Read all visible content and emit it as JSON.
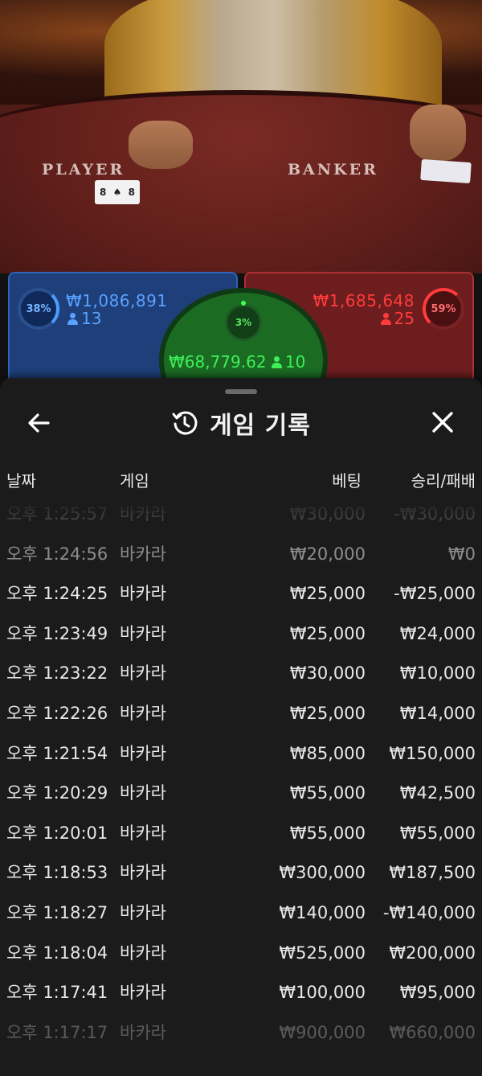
{
  "video": {
    "player_label": "PLAYER",
    "banker_label": "BANKER",
    "card_rank_top": "8",
    "card_rank_bottom": "8"
  },
  "bets": {
    "player": {
      "percent": "38%",
      "amount": "₩1,086,891",
      "players": "13",
      "color": "#5aa2ff"
    },
    "banker": {
      "percent": "59%",
      "amount": "₩1,685,648",
      "players": "25",
      "color": "#ff3b3b"
    },
    "tie": {
      "percent": "3%",
      "amount": "₩68,779.62",
      "players": "10",
      "color": "#3df05a"
    }
  },
  "history_sheet": {
    "title": "게임 기록",
    "columns": {
      "date": "날짜",
      "game": "게임",
      "bet": "베팅",
      "result": "승리/패배"
    },
    "rows": [
      {
        "time": "오후 1:25:57",
        "game": "바카라",
        "bet": "₩30,000",
        "result": "-₩30,000"
      },
      {
        "time": "오후 1:24:56",
        "game": "바카라",
        "bet": "₩20,000",
        "result": "₩0"
      },
      {
        "time": "오후 1:24:25",
        "game": "바카라",
        "bet": "₩25,000",
        "result": "-₩25,000"
      },
      {
        "time": "오후 1:23:49",
        "game": "바카라",
        "bet": "₩25,000",
        "result": "₩24,000"
      },
      {
        "time": "오후 1:23:22",
        "game": "바카라",
        "bet": "₩30,000",
        "result": "₩10,000"
      },
      {
        "time": "오후 1:22:26",
        "game": "바카라",
        "bet": "₩25,000",
        "result": "₩14,000"
      },
      {
        "time": "오후 1:21:54",
        "game": "바카라",
        "bet": "₩85,000",
        "result": "₩150,000"
      },
      {
        "time": "오후 1:20:29",
        "game": "바카라",
        "bet": "₩55,000",
        "result": "₩42,500"
      },
      {
        "time": "오후 1:20:01",
        "game": "바카라",
        "bet": "₩55,000",
        "result": "₩55,000"
      },
      {
        "time": "오후 1:18:53",
        "game": "바카라",
        "bet": "₩300,000",
        "result": "₩187,500"
      },
      {
        "time": "오후 1:18:27",
        "game": "바카라",
        "bet": "₩140,000",
        "result": "-₩140,000"
      },
      {
        "time": "오후 1:18:04",
        "game": "바카라",
        "bet": "₩525,000",
        "result": "₩200,000"
      },
      {
        "time": "오후 1:17:41",
        "game": "바카라",
        "bet": "₩100,000",
        "result": "₩95,000"
      },
      {
        "time": "오후 1:17:17",
        "game": "바카라",
        "bet": "₩900,000",
        "result": "₩660,000"
      }
    ]
  },
  "icons": {
    "back": "arrow-left-icon",
    "close": "close-icon",
    "history": "history-clock-icon",
    "person": "person-icon"
  }
}
